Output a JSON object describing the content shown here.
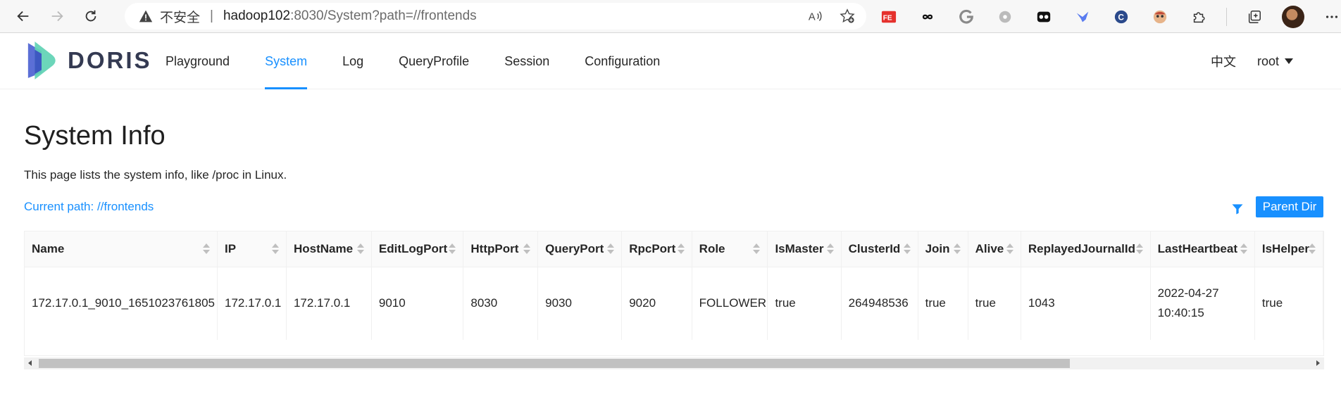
{
  "browser": {
    "url_insecure": "不安全",
    "url_separator": "|",
    "url_host": "hadoop102",
    "url_rest": ":8030/System?path=//frontends",
    "extensions": [
      "fe-icon",
      "infinity-icon",
      "g-icon",
      "settings-flower-icon",
      "mask-icon",
      "bird-icon",
      "c-icon",
      "face-icon",
      "puzzle-icon"
    ]
  },
  "header": {
    "logo_text": "DORIS",
    "menu": [
      {
        "label": "Playground"
      },
      {
        "label": "System"
      },
      {
        "label": "Log"
      },
      {
        "label": "QueryProfile"
      },
      {
        "label": "Session"
      },
      {
        "label": "Configuration"
      }
    ],
    "active_menu": "System",
    "lang": "中文",
    "user": "root"
  },
  "page": {
    "title": "System Info",
    "description": "This page lists the system info, like /proc in Linux.",
    "current_path": "Current path: //frontends",
    "parent_button": "Parent Dir"
  },
  "table": {
    "columns": [
      "Name",
      "IP",
      "HostName",
      "EditLogPort",
      "HttpPort",
      "QueryPort",
      "RpcPort",
      "Role",
      "IsMaster",
      "ClusterId",
      "Join",
      "Alive",
      "ReplayedJournalId",
      "LastHeartbeat",
      "IsHelper"
    ],
    "rows": [
      [
        "172.17.0.1_9010_1651023761805",
        "172.17.0.1",
        "172.17.0.1",
        "9010",
        "8030",
        "9030",
        "9020",
        "FOLLOWER",
        "true",
        "264948536",
        "true",
        "true",
        "1043",
        "2022-04-27 10:40:15",
        "true"
      ]
    ]
  },
  "colors": {
    "accent": "#1890ff",
    "logo_blue": "#5b6fd6",
    "logo_green": "#5fd3b4"
  }
}
